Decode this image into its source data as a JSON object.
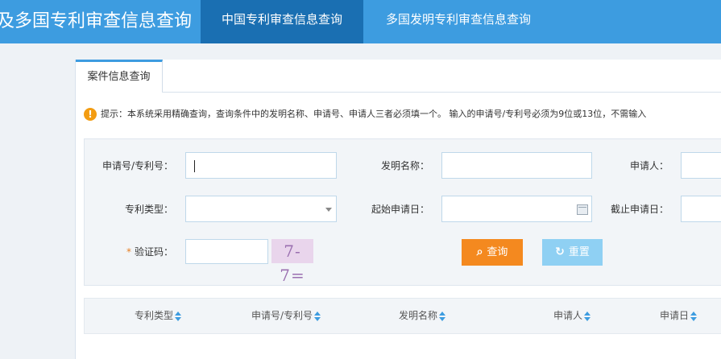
{
  "header": {
    "brand": "及多国专利审查信息查询",
    "tabs": [
      {
        "label": "中国专利审查信息查询",
        "active": true
      },
      {
        "label": "多国发明专利审查信息查询",
        "active": false
      }
    ]
  },
  "subtab": {
    "label": "案件信息查询"
  },
  "notice": {
    "icon": "warning-icon",
    "text": "提示：本系统采用精确查询，查询条件中的发明名称、申请号、申请人三者必须填一个。 输入的申请号/专利号必须为9位或13位，不需输入"
  },
  "form": {
    "app_no_label": "申请号/专利号：",
    "app_no_value": "",
    "invention_name_label": "发明名称：",
    "invention_name_value": "",
    "applicant_label": "申请人：",
    "applicant_value": "",
    "patent_type_label": "专利类型：",
    "patent_type_selected": "",
    "start_date_label": "起始申请日：",
    "start_date_value": "",
    "end_date_label": "截止申请日：",
    "end_date_value": "",
    "captcha_required_mark": "*",
    "captcha_label": "验证码：",
    "captcha_value": "",
    "captcha_image_text": "7-7="
  },
  "buttons": {
    "query_label": "查询",
    "reset_label": "重置"
  },
  "table": {
    "columns": [
      "专利类型",
      "申请号/专利号",
      "发明名称",
      "申请人",
      "申请日"
    ]
  },
  "colors": {
    "header_bg": "#3d9ce0",
    "active_tab_bg": "#1a6fb2",
    "query_button": "#f4891f",
    "reset_button": "#8fd0f3",
    "notice_icon": "#f39c12"
  }
}
